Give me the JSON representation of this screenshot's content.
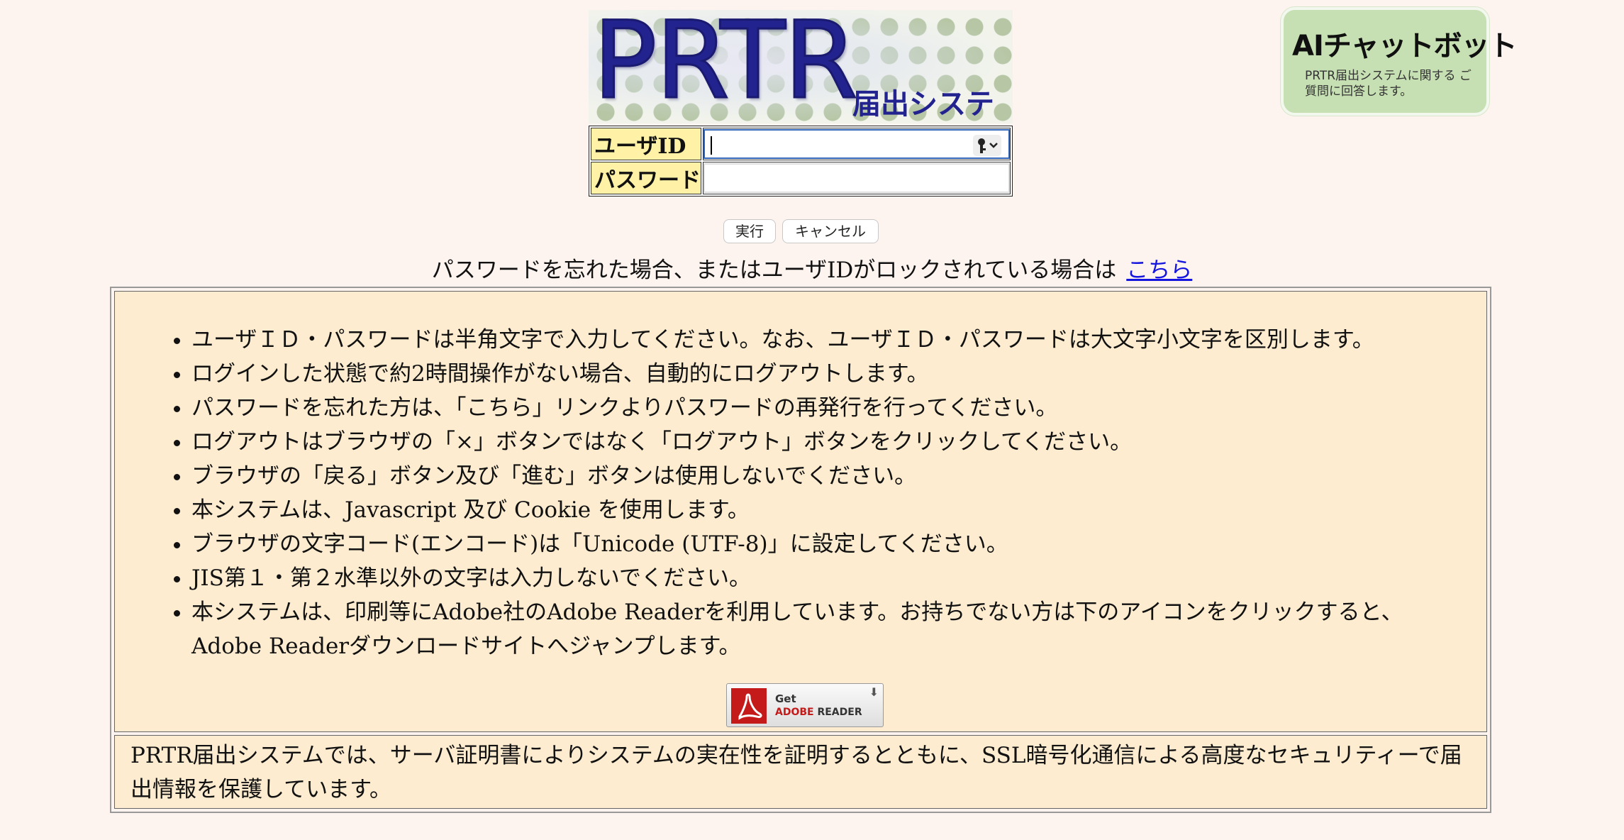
{
  "header": {
    "logo_main": "PRTR",
    "logo_sub": "届出システム"
  },
  "chatbot": {
    "title": "AIチャットボット",
    "description": "PRTR届出システムに関する ご質問に回答します。"
  },
  "login": {
    "user_id_label": "ユーザID",
    "user_id_value": "",
    "password_label": "パスワード",
    "password_value": ""
  },
  "buttons": {
    "submit_label": "実行",
    "cancel_label": "キャンセル"
  },
  "forgot": {
    "text": "パスワードを忘れた場合、またはユーザIDがロックされている場合は",
    "link_text": "こちら"
  },
  "notices": [
    "ユーザＩＤ・パスワードは半角文字で入力してください。なお、ユーザＩＤ・パスワードは大文字小文字を区別します。",
    "ログインした状態で約2時間操作がない場合、自動的にログアウトします。",
    "パスワードを忘れた方は、「こちら」リンクよりパスワードの再発行を行ってください。",
    "ログアウトはブラウザの「×」ボタンではなく「ログアウト」ボタンをクリックしてください。",
    "ブラウザの「戻る」ボタン及び「進む」ボタンは使用しないでください。",
    "本システムは、Javascript 及び Cookie を使用します。",
    "ブラウザの文字コード(エンコード)は「Unicode (UTF-8)」に設定してください。",
    "JIS第１・第２水準以外の文字は入力しないでください。",
    "本システムは、印刷等にAdobe社のAdobe Readerを利用しています。お持ちでない方は下のアイコンをクリックすると、Adobe Readerダウンロードサイトへジャンプします。"
  ],
  "adobe_badge": {
    "get": "Get",
    "brand": "ADOBE",
    "product": " READER"
  },
  "ssl_notice": "PRTR届出システムでは、サーバ証明書によりシステムの実在性を証明するとともに、SSL暗号化通信による高度なセキュリティーで届出情報を保護しています。",
  "colors": {
    "background": "#fdf4ef",
    "label_bg": "#fff2a6",
    "info_bg": "#fdecd0",
    "link": "#1515e0",
    "logo": "#23238f",
    "chatbot_bg": "#c6dfb3"
  }
}
